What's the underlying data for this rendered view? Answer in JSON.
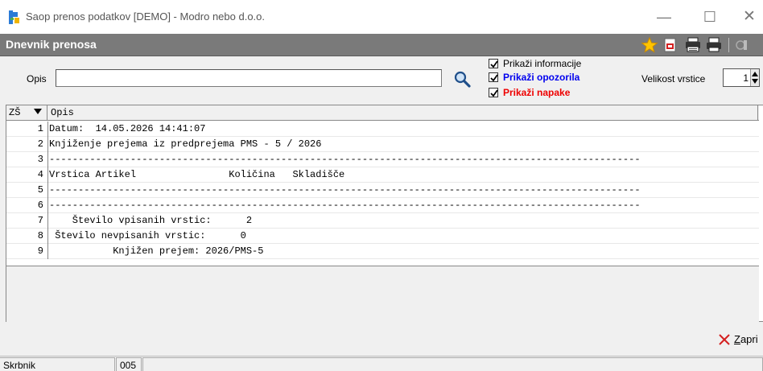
{
  "window": {
    "title": "Saop prenos podatkov [DEMO] - Modro nebo d.o.o.",
    "minimize_glyph": "—",
    "maximize_glyph": "☐",
    "close_glyph": "✕"
  },
  "panel": {
    "title": "Dnevnik prenosa",
    "toolbar_icons": [
      "star-icon",
      "pdf-icon",
      "print-stack-icon",
      "printer-icon",
      "more-icon"
    ]
  },
  "filter": {
    "opis_label": "Opis",
    "opis_value": "",
    "checkboxes": [
      {
        "label": "Prikaži informacije",
        "checked": true,
        "color": "#000000"
      },
      {
        "label": "Prikaži opozorila",
        "checked": true,
        "color": "#0000ee"
      },
      {
        "label": "Prikaži napake",
        "checked": true,
        "color": "#ee0000"
      }
    ],
    "row_size_label": "Velikost vrstice",
    "row_size_value": "1"
  },
  "grid": {
    "columns": [
      "ZŠ",
      "Opis"
    ],
    "rows": [
      {
        "num": "1",
        "text": "Datum:  14.05.2026 14:41:07"
      },
      {
        "num": "2",
        "text": "Knjiženje prejema iz predprejema PMS - 5 / 2026"
      },
      {
        "num": "3",
        "text": "------------------------------------------------------------------------------------------------------"
      },
      {
        "num": "4",
        "text": "Vrstica Artikel                Količina   Skladišče"
      },
      {
        "num": "5",
        "text": "------------------------------------------------------------------------------------------------------"
      },
      {
        "num": "6",
        "text": "------------------------------------------------------------------------------------------------------"
      },
      {
        "num": "7",
        "text": "    Število vpisanih vrstic:      2"
      },
      {
        "num": "8",
        "text": " Število nevpisanih vrstic:      0"
      },
      {
        "num": "9",
        "text": "           Knjižen prejem: 2026/PMS-5"
      }
    ]
  },
  "footer": {
    "close_hotkey": "Z",
    "close_rest": "apri"
  },
  "status": {
    "user": "Skrbnik",
    "code": "005",
    "message": ""
  },
  "colors": {
    "panel_bar": "#7a7a7a",
    "warning": "#0000ee",
    "error": "#ee0000",
    "close_x": "#d42020"
  }
}
